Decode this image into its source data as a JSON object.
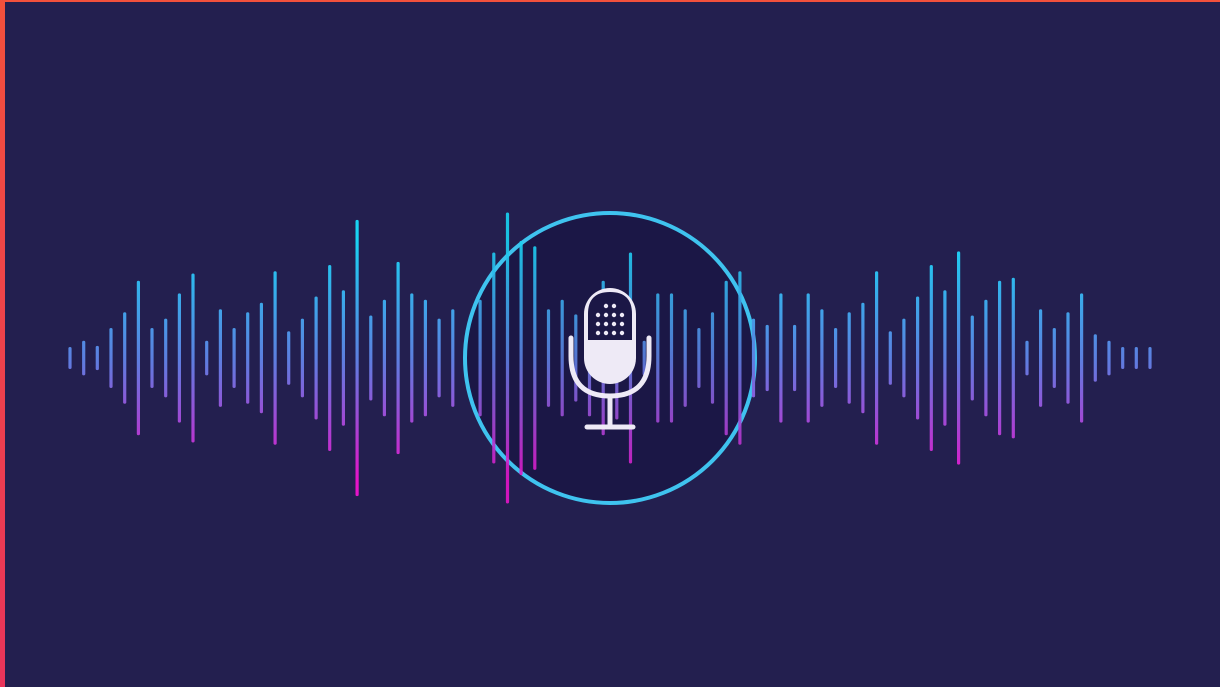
{
  "colors": {
    "background": "#231f4f",
    "circle_fill": "#1b1746",
    "ring": "#3fc3ef",
    "wave_top": "#19d3f2",
    "wave_mid": "#5d7ee0",
    "wave_bottom": "#e414c8",
    "microphone": "#eeeaf6",
    "frame_top": "#f2503c",
    "frame_left": "#e8345a"
  },
  "icons": {
    "center": "microphone-icon"
  },
  "waveform": {
    "amplitudes": [
      0.09,
      0.15,
      0.1,
      0.27,
      0.42,
      0.72,
      0.27,
      0.36,
      0.6,
      0.79,
      0.15,
      0.45,
      0.27,
      0.42,
      0.51,
      0.81,
      0.24,
      0.36,
      0.57,
      0.87,
      0.63,
      1.3,
      0.39,
      0.54,
      0.9,
      0.6,
      0.54,
      0.36,
      0.45,
      0.21,
      0.54,
      0.99,
      1.37,
      1.1,
      1.05,
      0.45,
      0.54,
      0.4,
      0.54,
      0.72,
      0.57,
      0.99,
      0.15,
      0.6,
      0.6,
      0.45,
      0.27,
      0.42,
      0.72,
      0.81,
      0.36,
      0.3,
      0.6,
      0.3,
      0.6,
      0.45,
      0.27,
      0.42,
      0.51,
      0.81,
      0.24,
      0.36,
      0.57,
      0.87,
      0.63,
      1.0,
      0.39,
      0.54,
      0.72,
      0.75,
      0.15,
      0.45,
      0.27,
      0.42,
      0.6,
      0.21,
      0.15,
      0.09,
      0.09,
      0.09
    ]
  }
}
